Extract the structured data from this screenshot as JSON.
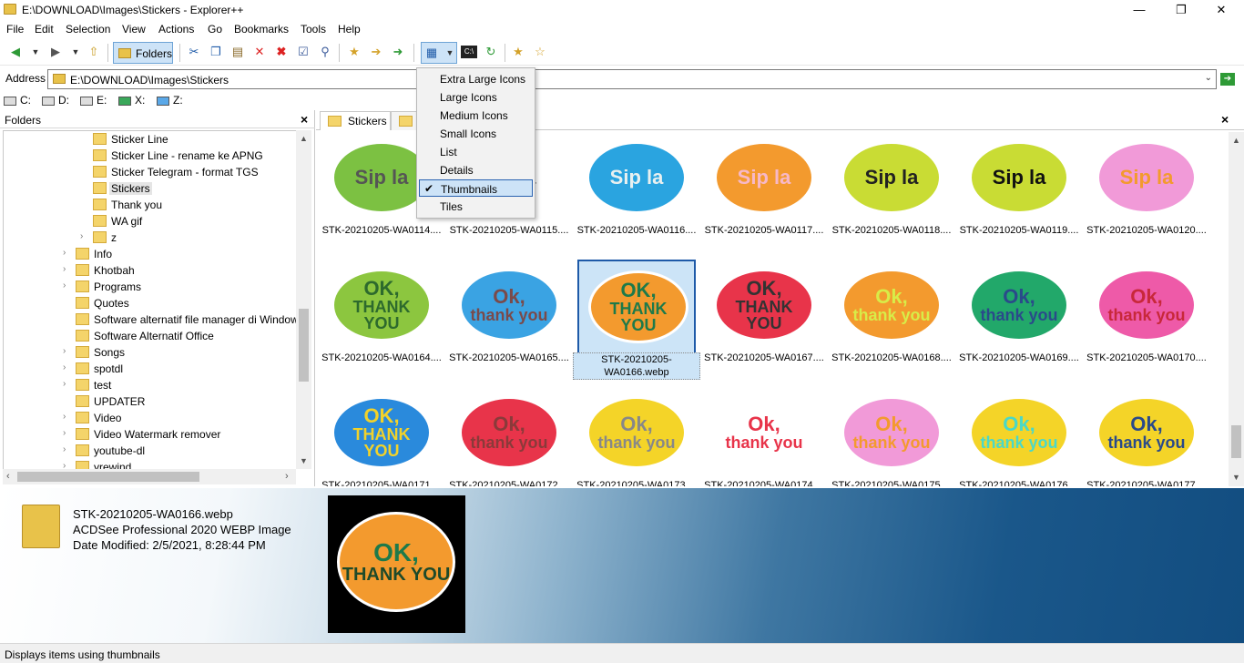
{
  "window": {
    "title": "E:\\DOWNLOAD\\Images\\Stickers - Explorer++",
    "minimize": "—",
    "maximize": "❐",
    "close": "✕"
  },
  "menu": [
    "File",
    "Edit",
    "Selection",
    "View",
    "Actions",
    "Go",
    "Bookmarks",
    "Tools",
    "Help"
  ],
  "toolbar": {
    "folders_label": "Folders"
  },
  "address": {
    "label": "Address",
    "value": "E:\\DOWNLOAD\\Images\\Stickers"
  },
  "drives": [
    "C:",
    "D:",
    "E:",
    "X:",
    "Z:"
  ],
  "folders_pane": {
    "title": "Folders",
    "items": [
      {
        "label": "Sticker Line",
        "level": 2
      },
      {
        "label": "Sticker Line - rename ke APNG",
        "level": 2
      },
      {
        "label": "Sticker Telegram - format TGS",
        "level": 2
      },
      {
        "label": "Stickers",
        "level": 2,
        "selected": true
      },
      {
        "label": "Thank you",
        "level": 2
      },
      {
        "label": "WA gif",
        "level": 2
      },
      {
        "label": "z",
        "level": 2,
        "expandable": true
      },
      {
        "label": "Info",
        "level": 1,
        "expandable": true
      },
      {
        "label": "Khotbah",
        "level": 1,
        "expandable": true
      },
      {
        "label": "Programs",
        "level": 1,
        "expandable": true
      },
      {
        "label": "Quotes",
        "level": 1
      },
      {
        "label": "Software alternatif file manager di Window",
        "level": 1
      },
      {
        "label": "Software Alternatif Office",
        "level": 1
      },
      {
        "label": "Songs",
        "level": 1,
        "expandable": true
      },
      {
        "label": "spotdl",
        "level": 1,
        "expandable": true
      },
      {
        "label": "test",
        "level": 1,
        "expandable": true
      },
      {
        "label": "UPDATER",
        "level": 1
      },
      {
        "label": "Video",
        "level": 1,
        "expandable": true
      },
      {
        "label": "Video Watermark remover",
        "level": 1,
        "expandable": true
      },
      {
        "label": "youtube-dl",
        "level": 1,
        "expandable": true
      },
      {
        "label": "yrewind",
        "level": 1,
        "expandable": true
      }
    ]
  },
  "tabs": [
    {
      "label": "Stickers",
      "active": true
    },
    {
      "label": "",
      "active": false
    }
  ],
  "view_menu": {
    "items": [
      "Extra Large Icons",
      "Large Icons",
      "Medium Icons",
      "Small Icons",
      "List",
      "Details",
      "Thumbnails",
      "Tiles"
    ],
    "checked": "Thumbnails",
    "check_mark": "✔"
  },
  "thumbnails": [
    {
      "caption": "STK-20210205-WA0114....",
      "line1": "Sip la",
      "line2": "",
      "bg": "#7cc142",
      "fg": "#555555"
    },
    {
      "caption": "STK-20210205-WA0115....",
      "line1": "Sip la",
      "line2": "",
      "bg": "#ffffff",
      "fg": "#333333"
    },
    {
      "caption": "STK-20210205-WA0116....",
      "line1": "Sip la",
      "line2": "",
      "bg": "#2aa4e0",
      "fg": "#e8f0f0"
    },
    {
      "caption": "STK-20210205-WA0117....",
      "line1": "Sip la",
      "line2": "",
      "bg": "#f39a2e",
      "fg": "#f7b8c8"
    },
    {
      "caption": "STK-20210205-WA0118....",
      "line1": "Sip la",
      "line2": "",
      "bg": "#c9dc34",
      "fg": "#222222"
    },
    {
      "caption": "STK-20210205-WA0119....",
      "line1": "Sip la",
      "line2": "",
      "bg": "#c9dc34",
      "fg": "#111111"
    },
    {
      "caption": "STK-20210205-WA0120....",
      "line1": "Sip la",
      "line2": "",
      "bg": "#f19ad8",
      "fg": "#f39a2e"
    },
    {
      "caption": "STK-20210205-WA0164....",
      "line1": "OK,",
      "line2": "THANK YOU",
      "bg": "#8cc63f",
      "fg": "#2d6a2d"
    },
    {
      "caption": "STK-20210205-WA0165....",
      "line1": "Ok,",
      "line2": "thank you",
      "bg": "#3aa3e3",
      "fg": "#7a4a4a"
    },
    {
      "caption": "STK-20210205-WA0166.webp",
      "line1": "OK,",
      "line2": "THANK YOU",
      "bg": "#f39a2e",
      "fg": "#1e7a4a",
      "selected": true
    },
    {
      "caption": "STK-20210205-WA0167....",
      "line1": "OK,",
      "line2": "THANK YOU",
      "bg": "#e8344a",
      "fg": "#333333"
    },
    {
      "caption": "STK-20210205-WA0168....",
      "line1": "Ok,",
      "line2": "thank you",
      "bg": "#f39a2e",
      "fg": "#d8ec48"
    },
    {
      "caption": "STK-20210205-WA0169....",
      "line1": "Ok,",
      "line2": "thank you",
      "bg": "#22a86a",
      "fg": "#2a4a8a"
    },
    {
      "caption": "STK-20210205-WA0170....",
      "line1": "Ok,",
      "line2": "thank you",
      "bg": "#ee5aa8",
      "fg": "#c8283a"
    },
    {
      "caption": "STK-20210205-WA0171....",
      "line1": "OK,",
      "line2": "THANK YOU",
      "bg": "#2a8adc",
      "fg": "#f2d22a"
    },
    {
      "caption": "STK-20210205-WA0172....",
      "line1": "Ok,",
      "line2": "thank you",
      "bg": "#e8344a",
      "fg": "#8a3a3a"
    },
    {
      "caption": "STK-20210205-WA0173....",
      "line1": "Ok,",
      "line2": "thank you",
      "bg": "#f4d428",
      "fg": "#888888"
    },
    {
      "caption": "STK-20210205-WA0174....",
      "line1": "Ok,",
      "line2": "thank you",
      "bg": "#ffffff",
      "fg": "#e8344a"
    },
    {
      "caption": "STK-20210205-WA0175....",
      "line1": "Ok,",
      "line2": "thank you",
      "bg": "#f19ad8",
      "fg": "#f39a2e"
    },
    {
      "caption": "STK-20210205-WA0176....",
      "line1": "Ok,",
      "line2": "thank you",
      "bg": "#f4d428",
      "fg": "#4ad8c8"
    },
    {
      "caption": "STK-20210205-WA0177....",
      "line1": "Ok,",
      "line2": "thank you",
      "bg": "#f4d428",
      "fg": "#2a4a8a"
    }
  ],
  "preview": {
    "filename": "STK-20210205-WA0166.webp",
    "type": "ACDSee Professional 2020 WEBP Image",
    "modified": "Date Modified: 2/5/2021, 8:28:44 PM",
    "line1": "OK,",
    "line2": "THANK YOU"
  },
  "status": {
    "text": "Displays items using thumbnails"
  },
  "colors": {
    "accent": "#cde3f7",
    "selection_border": "#1e5aa8"
  }
}
